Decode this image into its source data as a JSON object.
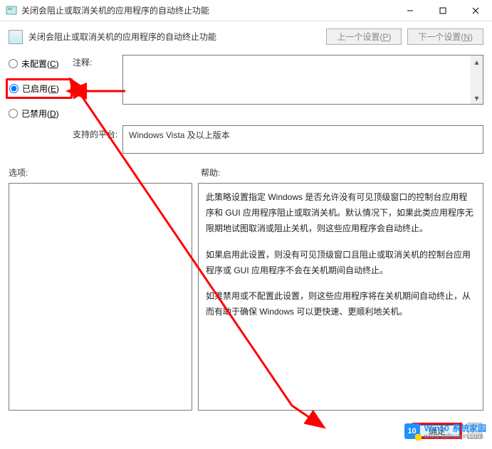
{
  "window": {
    "title": "关闭会阻止或取消关机的应用程序的自动终止功能",
    "minimize_icon": "minimize-icon",
    "maximize_icon": "maximize-icon",
    "close_icon": "close-icon"
  },
  "header": {
    "title": "关闭会阻止或取消关机的应用程序的自动终止功能",
    "prev_label_pre": "上一个设置(",
    "prev_key": "P",
    "prev_label_post": ")",
    "next_label_pre": "下一个设置(",
    "next_key": "N",
    "next_label_post": ")"
  },
  "radios": {
    "not_configured_pre": "未配置(",
    "not_configured_key": "C",
    "not_configured_post": ")",
    "enabled_pre": "已启用(",
    "enabled_key": "E",
    "enabled_post": ")",
    "disabled_pre": "已禁用(",
    "disabled_key": "D",
    "disabled_post": ")",
    "selected": "enabled"
  },
  "labels": {
    "comment": "注释:",
    "platform": "支持的平台:",
    "options": "选项:",
    "help": "帮助:"
  },
  "platform_text": "Windows Vista 及以上版本",
  "help_paragraphs": [
    "此策略设置指定 Windows 是否允许没有可见顶级窗口的控制台应用程序和 GUI 应用程序阻止或取消关机。默认情况下，如果此类应用程序无限期地试图取消或阻止关机，则这些应用程序会自动终止。",
    "如果启用此设置，则没有可见顶级窗口且阻止或取消关机的控制台应用程序或 GUI 应用程序不会在关机期间自动终止。",
    "如果禁用或不配置此设置，则这些应用程序将在关机期间自动终止，从而有助于确保 Windows 可以更快速、更顺利地关机。"
  ],
  "buttons": {
    "ok": "确定"
  },
  "watermark": {
    "badge": "10",
    "line1": "Win10",
    "line2": "系统家园",
    "url": "www.qdhuajin.com"
  }
}
